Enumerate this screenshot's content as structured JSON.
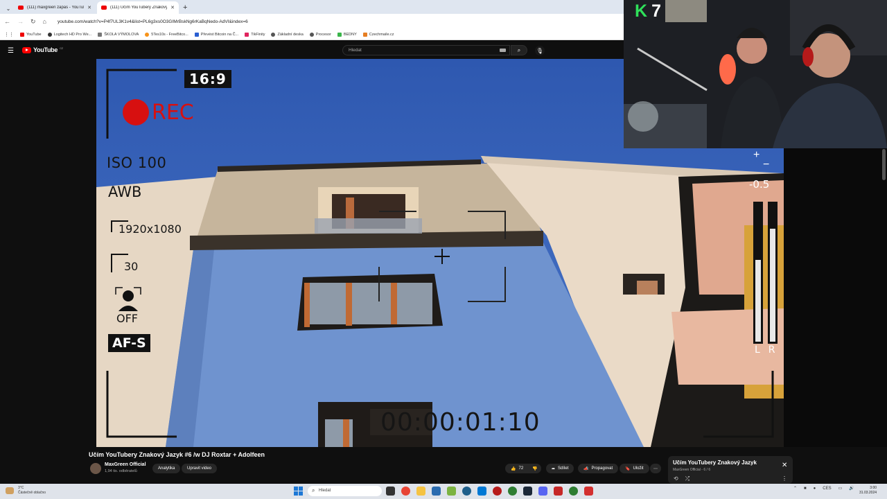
{
  "browser": {
    "tabs": [
      {
        "title": "(111) maxgreen zapas - YouTub",
        "active": false
      },
      {
        "title": "(111) Učím YouTubery Znakový",
        "active": true
      }
    ],
    "url": "youtube.com/watch?v=P4f7UL3K1v4&list=PL6g3xs0O3GIMrBskNg6rKaBqNedo-AdVI&index=6",
    "bookmarks": [
      "YouTube",
      "Logitech HD Pro We...",
      "ŠKOLA VÝMOLOVA",
      "5Tes10s - FreeBitco...",
      "Převést Bitcoin na Č...",
      "TikFinity",
      "Základní deska",
      "Procesor",
      "BEDNY",
      "Czechmaile.cz"
    ]
  },
  "youtube": {
    "logo_text": "YouTube",
    "country": "CZ",
    "search_placeholder": "Hledat"
  },
  "video": {
    "overlay": {
      "aspect": "16:9",
      "rec": "REC",
      "iso": "ISO 100",
      "wb": "AWB",
      "resolution": "1920x1080",
      "fps": "30",
      "face": "OFF",
      "focus": "AF-S",
      "timecode": "00:00:01:10",
      "ev": "-0.5",
      "channels": "LR"
    },
    "title": "Učím YouTubery Znakový Jazyk #6 /w DJ Roxtar + Adolfeen",
    "channel": "MaxGreen Official",
    "subscribers": "1,94 tis. odběratelů",
    "buttons": {
      "analytics": "Analytika",
      "edit": "Upravit video",
      "likes": "72",
      "share": "Sdílet",
      "promote": "Propagovat",
      "save": "Uložit"
    }
  },
  "stream_overlay": {
    "k_badge": "K",
    "k_count": "7"
  },
  "miniplayer": {
    "title": "Učím YouTubery Znakový Jazyk",
    "subtitle": "MaxGreen Official - 6 / 6"
  },
  "taskbar": {
    "weather_temp": "3°C",
    "weather_desc": "Částečně oblačno",
    "search_placeholder": "Hledat",
    "lang": "CES",
    "time": "3:00",
    "date": "31.03.2024"
  },
  "colors": {
    "accent": "#ff0000",
    "rec": "#d71010",
    "k_green": "#2fe05a"
  }
}
